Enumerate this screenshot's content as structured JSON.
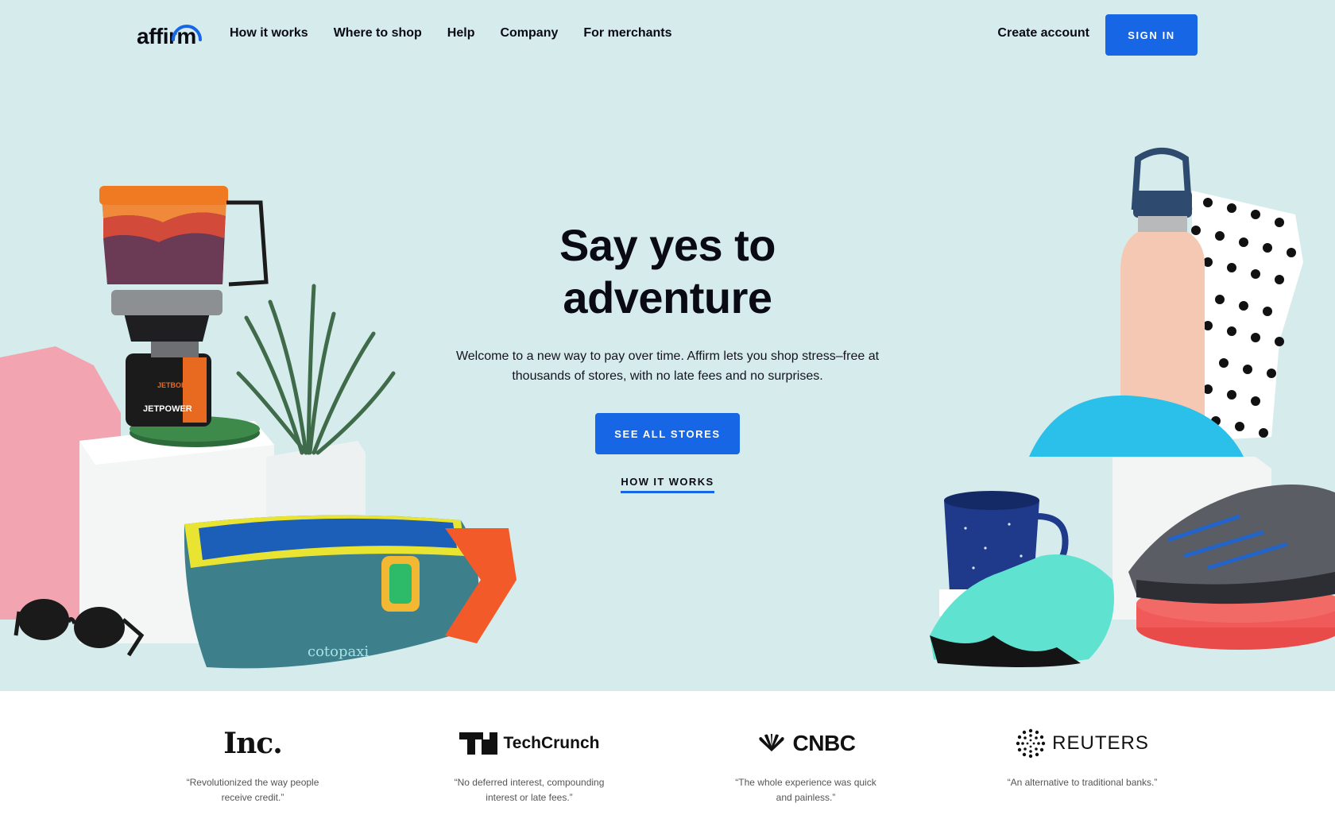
{
  "nav": {
    "logo_text": "affirm",
    "links": [
      "How it works",
      "Where to shop",
      "Help",
      "Company",
      "For merchants"
    ],
    "create_account": "Create account",
    "sign_in": "SIGN IN"
  },
  "hero": {
    "headline_line1": "Say yes to",
    "headline_line2": "adventure",
    "subtext": "Welcome to a new way to pay over time. Affirm lets you shop stress–free at thousands of stores, with no late fees and no surprises.",
    "cta": "SEE ALL STORES",
    "secondary_link": "HOW IT WORKS",
    "product_text": {
      "stove_brand": "JETBOIL",
      "stove_model": "JETPOWER",
      "bag_brand": "cotopaxi"
    }
  },
  "press": [
    {
      "name": "Inc.",
      "quote": "“Revolutionized the way people receive credit.”"
    },
    {
      "name": "TechCrunch",
      "quote": "“No deferred interest, compounding interest or late fees.”"
    },
    {
      "name": "CNBC",
      "quote": "“The whole experience was quick and painless.”"
    },
    {
      "name": "REUTERS",
      "quote": "“An alternative to traditional banks.”"
    }
  ],
  "colors": {
    "hero_bg": "#d6ecec",
    "brand_blue": "#1766e6",
    "text": "#0a0a14"
  }
}
